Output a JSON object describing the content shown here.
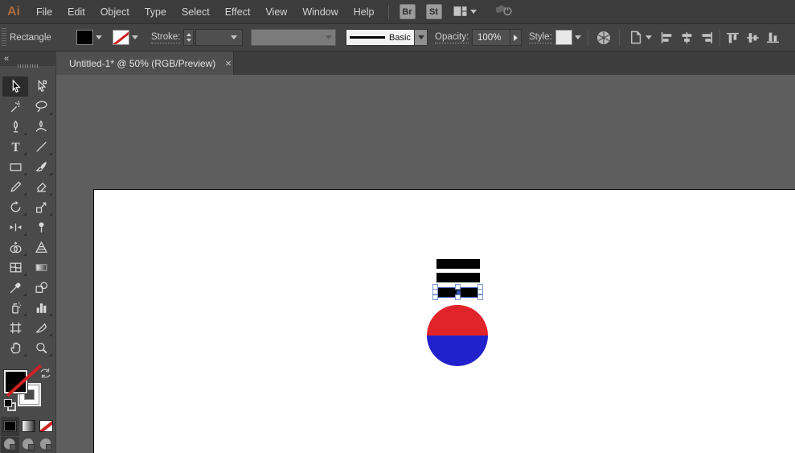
{
  "app": {
    "logo_text": "Ai"
  },
  "menubar": {
    "items": [
      "File",
      "Edit",
      "Object",
      "Type",
      "Select",
      "Effect",
      "View",
      "Window",
      "Help"
    ],
    "bridge_button": "Br",
    "stock_button": "St"
  },
  "controlbar": {
    "selection_type_label": "Rectangle",
    "stroke_label": "Stroke:",
    "brush_definition_value": "Basic",
    "opacity_label": "Opacity:",
    "opacity_value": "100%",
    "style_label": "Style:"
  },
  "tabbar": {
    "document_tab_title": "Untitled-1* @ 50% (RGB/Preview)",
    "close_glyph": "×",
    "collapse_glyph": "«"
  },
  "toolbar": {
    "active_tool": "selection",
    "tools": [
      "selection",
      "direct-selection",
      "magic-wand",
      "lasso",
      "pen",
      "curvature",
      "type",
      "line-segment",
      "rectangle",
      "paintbrush",
      "shaper",
      "eraser",
      "rotate",
      "scale",
      "width",
      "puppet-warp",
      "shape-builder",
      "perspective-grid",
      "mesh",
      "gradient",
      "eyedropper",
      "blend",
      "symbol-sprayer",
      "column-graph",
      "artboard",
      "slice",
      "hand",
      "zoom"
    ]
  },
  "fill_stroke": {
    "fill_color": "#000000",
    "stroke_value": "none"
  },
  "canvas": {
    "pasteboard_color": "#5e5e5e",
    "artboard_color": "#ffffff",
    "bars_color": "#000000",
    "circle_top_color": "#e1242a",
    "circle_bottom_color": "#2222cc",
    "selection_accent": "#3a57b0"
  }
}
